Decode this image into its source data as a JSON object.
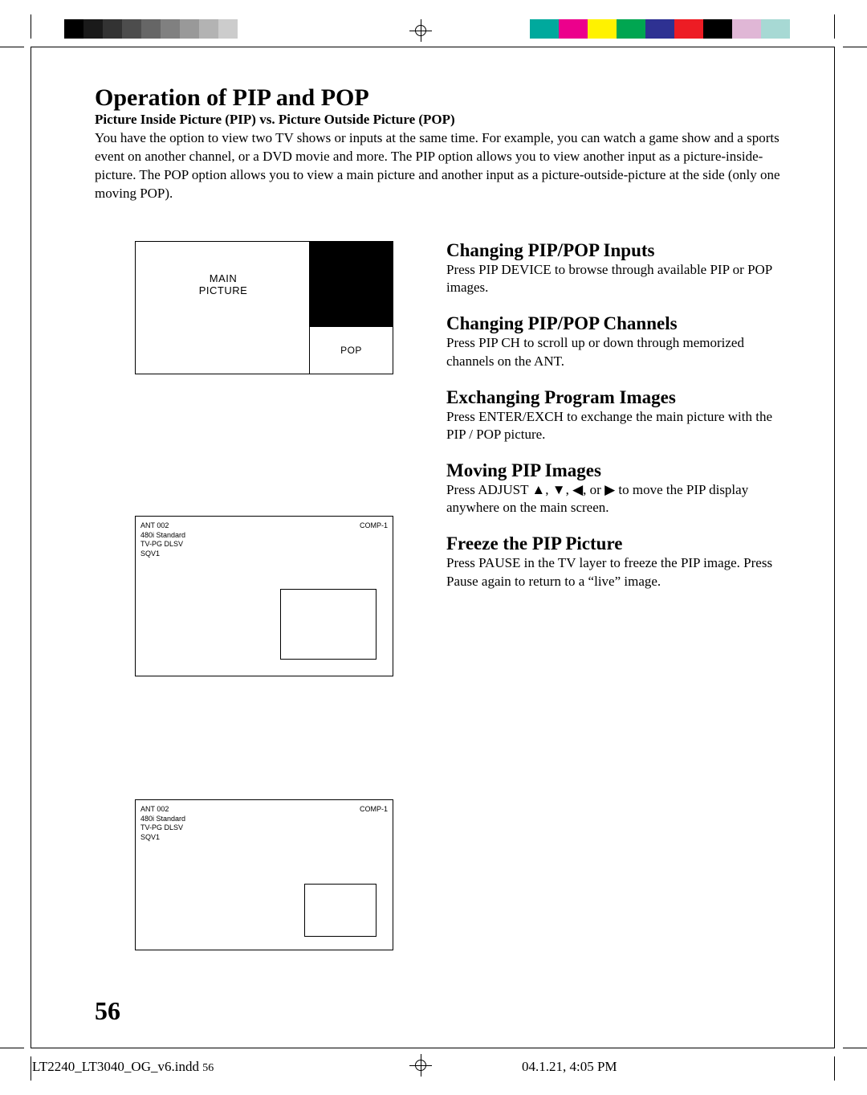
{
  "title": "Operation of PIP and POP",
  "subhead": "Picture Inside Picture (PIP) vs. Picture Outside Picture (POP)",
  "intro": "You have the option to view two TV shows or inputs at the same time.  For example, you can watch a game show and a sports event on another channel, or a DVD movie and more.  The PIP option allows you to view another input as a picture-inside-picture.  The POP option allows you to view a main picture and another input as a picture-outside-picture at the side (only one moving POP).",
  "popfig": {
    "main": "MAIN\nPICTURE",
    "pop": "POP"
  },
  "monitor": {
    "tl": [
      "ANT 002",
      "480i Standard",
      "TV-PG DLSV",
      "SQV1"
    ],
    "tr": "COMP-1"
  },
  "sections": [
    {
      "h": "Changing PIP/POP Inputs",
      "p": "Press PIP DEVICE to browse through available PIP or POP images."
    },
    {
      "h": "Changing PIP/POP Channels",
      "p": "Press PIP CH to scroll up or down through memorized channels on the ANT."
    },
    {
      "h": "Exchanging Program Images",
      "p": "Press ENTER/EXCH to exchange the main picture with the PIP / POP picture."
    },
    {
      "h": "Moving PIP Images",
      "p": "Press ADJUST ▲, ▼, ◀, or ▶ to move the PIP display anywhere on the main screen."
    },
    {
      "h": "Freeze the PIP Picture",
      "p": "Press PAUSE in the TV layer to freeze the PIP image.  Press Pause again to return to a “live” image."
    }
  ],
  "page_number": "56",
  "footer": {
    "file": "LT2240_LT3040_OG_v6.indd",
    "page_small": "56",
    "timestamp": "04.1.21, 4:05 PM"
  },
  "colors": {
    "gray": [
      "#000",
      "#1a1a1a",
      "#333",
      "#4d4d4d",
      "#666",
      "#808080",
      "#999",
      "#b3b3b3",
      "#ccc",
      "#fff"
    ],
    "color": [
      "#00a99d",
      "#ec008c",
      "#fff200",
      "#00a651",
      "#2e3192",
      "#ed1c24",
      "#000",
      "#e0b7d6",
      "#a7d9d4"
    ]
  }
}
